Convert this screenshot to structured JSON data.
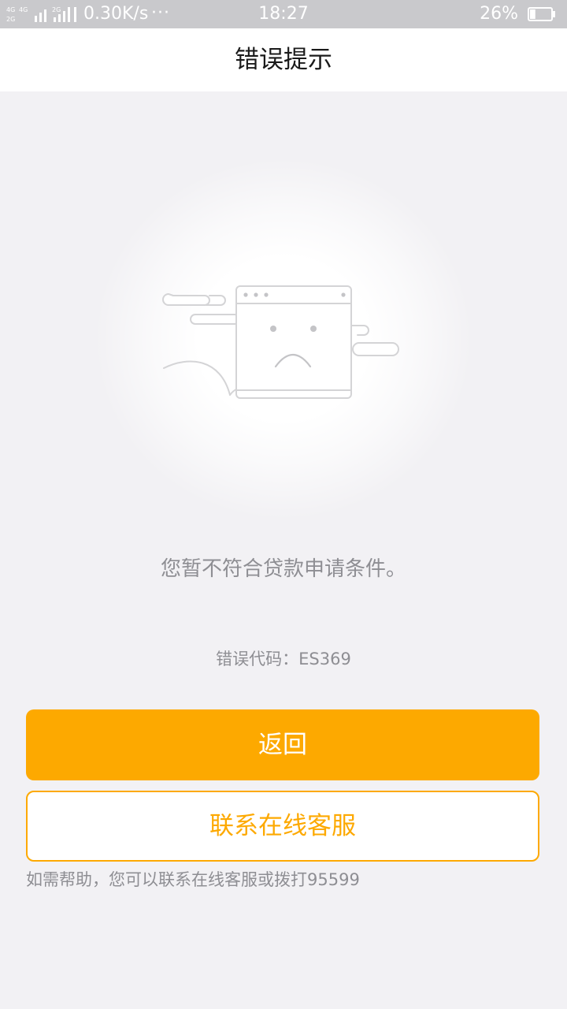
{
  "status_bar": {
    "network_speed": "0.30K/s",
    "more_dots": "···",
    "time": "18:27",
    "battery_percent": "26%",
    "battery_level": 0.26,
    "signal_labels": [
      "4G",
      "4G",
      "2G",
      "2G"
    ]
  },
  "header": {
    "title": "错误提示"
  },
  "illustration": {
    "icon": "sad-browser-window-with-clouds"
  },
  "main": {
    "message": "您暂不符合贷款申请条件。",
    "error_code": "错误代码：ES369"
  },
  "actions": {
    "back_label": "返回",
    "contact_label": "联系在线客服"
  },
  "footer": {
    "help_text": "如需帮助，您可以联系在线客服或拨打95599"
  },
  "colors": {
    "accent": "#fda900",
    "background": "#f2f1f4",
    "status_bar": "#c9c9cc",
    "muted_text": "#8e8e93"
  }
}
